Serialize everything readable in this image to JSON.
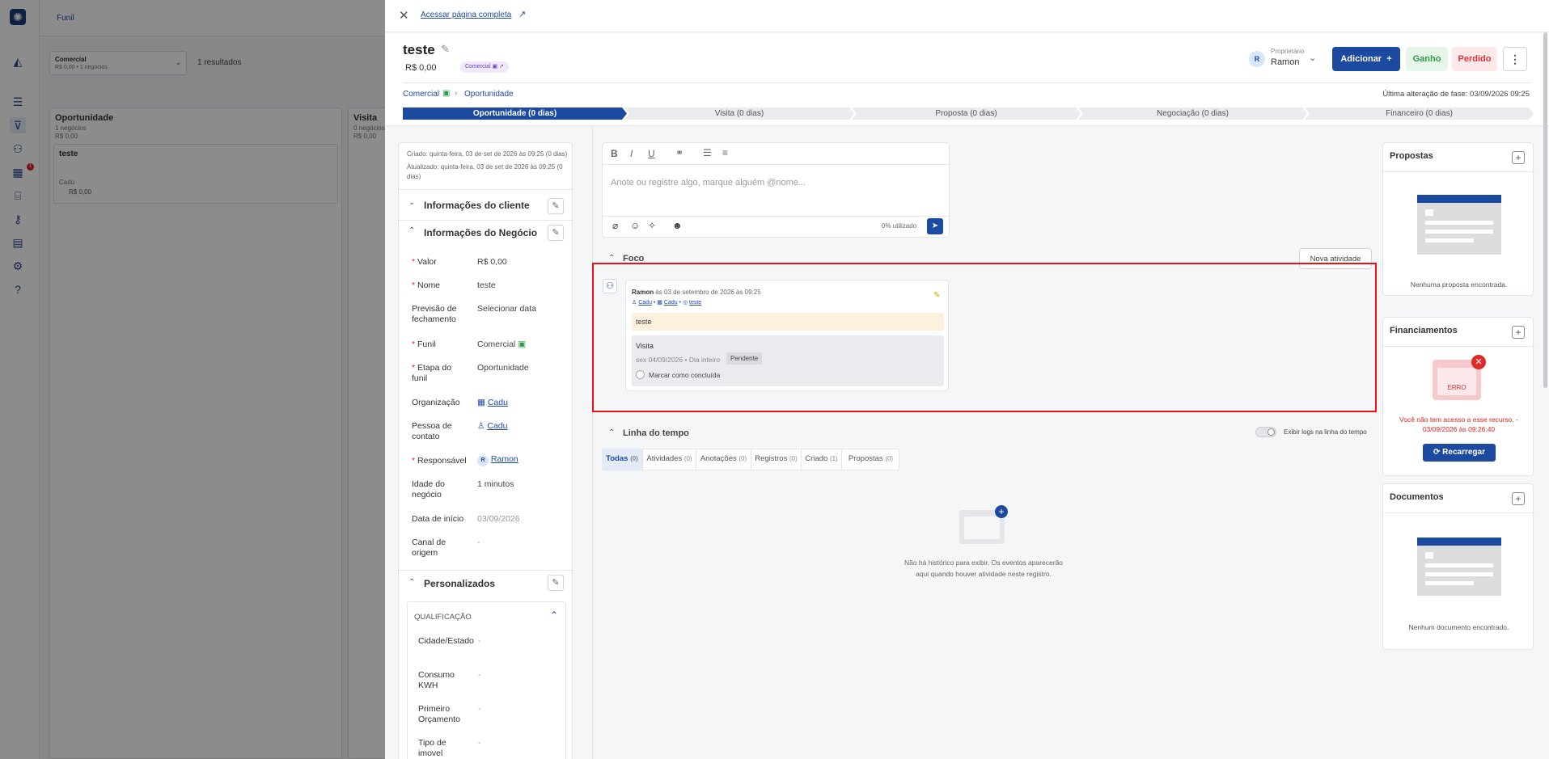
{
  "bg": {
    "nav_title": "Funil",
    "filter_title": "Comercial",
    "filter_sub": "R$ 0,00 • 1 negócios",
    "results": "1 resultados",
    "col1": {
      "title": "Oportunidade",
      "count": "1 negócios",
      "value": "R$ 0,00"
    },
    "col2": {
      "title": "Visita",
      "count": "0 negócios",
      "value": "R$ 0,00"
    },
    "card": {
      "title": "teste",
      "person": "Cadu",
      "value": "R$ 0,00"
    },
    "notif_badge": "1"
  },
  "top": {
    "link": "Acessar página completa"
  },
  "deal": {
    "title": "teste",
    "value": "R$ 0,00",
    "tag": "Comercial"
  },
  "owner": {
    "label": "Proprietário",
    "name": "Ramon",
    "avatar": "R"
  },
  "actions": {
    "add": "Adicionar",
    "won": "Ganho",
    "lost": "Perdido"
  },
  "breadcrumb": {
    "funnel": "Comercial",
    "stage": "Oportunidade"
  },
  "last_change": "Última alteração de fase: 03/09/2026 09:25",
  "stages": [
    "Oportunidade (0 dias)",
    "Visita (0 dias)",
    "Proposta (0 dias)",
    "Negociação (0 dias)",
    "Financeiro (0 dias)"
  ],
  "left": {
    "created": "Criado: quinta-feira, 03 de set de 2026 às 09:25 (0 dias)",
    "updated": "Atualizado: quinta-feira, 03 de set de 2026 às 09:25 (0 dias)",
    "client_section": "Informações do cliente",
    "deal_section": "Informações do Negócio",
    "fields": [
      {
        "label": "Valor",
        "value": "R$ 0,00",
        "req": "*"
      },
      {
        "label": "Nome",
        "value": "teste",
        "req": "*"
      },
      {
        "label": "Previsão de fechamento",
        "value": "Selecionar data",
        "req": ""
      },
      {
        "label": "Funil",
        "value": "Comercial",
        "req": "*"
      },
      {
        "label": "Etapa do funil",
        "value": "Oportunidade",
        "req": "*"
      },
      {
        "label": "Organização",
        "value": "Cadu",
        "req": ""
      },
      {
        "label": "Pessoa de contato",
        "value": "Cadu",
        "req": ""
      },
      {
        "label": "Responsável",
        "value": "Ramon",
        "req": "*"
      },
      {
        "label": "Idade do negócio",
        "value": "1 minutos",
        "req": ""
      },
      {
        "label": "Data de início",
        "value": "03/09/2026",
        "req": ""
      },
      {
        "label": "Canal de origem",
        "value": "-",
        "req": ""
      }
    ],
    "custom_section": "Personalizados",
    "qual_title": "QUALIFICAÇÃO",
    "qual": [
      {
        "label": "Cidade/Estado",
        "value": "-"
      },
      {
        "label": "Consumo KWH",
        "value": "-"
      },
      {
        "label": "Primeiro Orçamento",
        "value": "-"
      },
      {
        "label": "Tipo de imovel",
        "value": "-"
      }
    ]
  },
  "editor": {
    "placeholder": "Anote ou registre algo, marque alguém @nome...",
    "usage": "0% utilizado"
  },
  "focus": {
    "title": "Foco",
    "new_activity": "Nova atividade",
    "author": "Ramon",
    "time": "às 03 de setembro de 2026 às 09:25",
    "links": [
      "Cadu",
      "Cadu",
      "teste"
    ],
    "note": "teste",
    "activity_type": "Visita",
    "activity_date": "sex 04/09/2026 • Dia inteiro",
    "status": "Pendente",
    "mark_done": "Marcar como concluída"
  },
  "timeline": {
    "title": "Linha do tempo",
    "toggle_label": "Exibir logs na linha do tempo",
    "tabs": [
      {
        "label": "Todas",
        "count": "(0)"
      },
      {
        "label": "Atividades",
        "count": "(0)"
      },
      {
        "label": "Anotações",
        "count": "(0)"
      },
      {
        "label": "Registros",
        "count": "(0)"
      },
      {
        "label": "Criado",
        "count": "(1)"
      },
      {
        "label": "Propostas",
        "count": "(0)"
      }
    ],
    "empty": "Não há histórico para exibir. Os eventos aparecerão aqui quando houver atividade neste registro."
  },
  "side": {
    "proposals": "Propostas",
    "proposals_empty": "Nenhuma proposta encontrada.",
    "financing": "Financiamentos",
    "error_tag": "ERRO",
    "error_msg": "Você não tem acesso a esse recurso. - 03/09/2026 às 09:26:40",
    "reload": "Recarregar",
    "documents": "Documentos",
    "documents_empty": "Nenhum documento encontrado."
  }
}
